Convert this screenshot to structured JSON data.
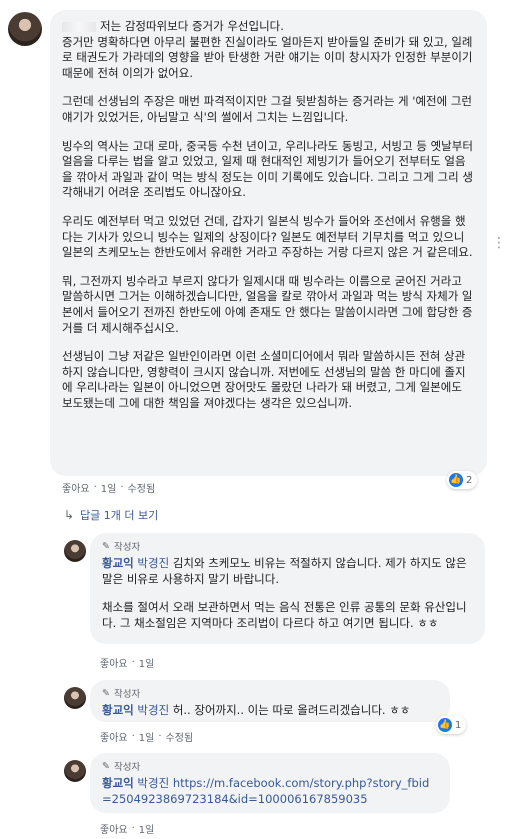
{
  "main_comment": {
    "paragraphs": [
      "저는 감정따위보다 증거가 우선입니다.\n증거만 명확하다면 아무리 불편한 진실이라도 얼마든지 받아들일 준비가 돼 있고, 일례로 태권도가 가라데의 영향을 받아 탄생한 거란 얘기는 이미 창시자가 인정한 부분이기 때문에 전혀 이의가 없어요.",
      "그런데 선생님의 주장은 매번 파격적이지만 그걸 뒷받침하는 증거라는 게 '예전에 그런 얘기가 있었거든, 아님말고 식'의 썰에서 그치는 느낌입니다.",
      "빙수의 역사는 고대 로마, 중국등 수천 년이고, 우리나라도 동빙고, 서빙고 등 옛날부터 얼음을 다루는 법을 알고 있었고, 일제 때 현대적인 제빙기가 들어오기 전부터도 얼음을 깎아서 과일과 같이 먹는 방식 정도는 이미 기록에도 있습니다. 그리고 그게 그리 생각해내기 어려운 조리법도 아니잖아요.",
      "우리도 예전부터 먹고 있었던 건데, 갑자기 일본식 빙수가 들어와 조선에서 유행을 했다는 기사가 있으니 빙수는 일제의 상징이다? 일본도 예전부터 기무치를 먹고 있으니 일본의 츠케모노는 한반도에서 유래한 거라고 주장하는 거랑 다르지 않은 거 같은데요.",
      "뭐, 그전까지 빙수라고 부르지 않다가 일제시대 때 빙수라는 이름으로 굳어진 거라고 말씀하시면 그거는 이해하겠습니다만, 얼음을 칼로 깎아서 과일과 먹는 방식 자체가 일본에서 들어오기 전까진 한반도에 아예 존재도 안 했다는 말씀이시라면 그에 합당한 증거를 더 제시해주십시오.",
      "선생님이 그냥 저같은 일반인이라면 이런 소셜미디어에서 뭐라 말씀하시든 전혀 상관하지 않습니다만, 영향력이 크시지 않습니까. 저번에도 선생님의 말씀 한 마디에 졸지에 우리나라는 일본이 아니었으면 장어맛도 몰랐던 나라가 돼 버렸고, 그게 일본에도 보도됐는데 그에 대한 책임을 져야겠다는 생각은 있으십니까."
    ],
    "actions": {
      "like": "좋아요",
      "reply": "1일",
      "edited": "수정됨"
    },
    "reaction_count": "2",
    "more_icon": "⋮"
  },
  "replies_link": {
    "label": "답글 1개 더 보기",
    "icon": "reply-arrow-icon"
  },
  "replies": [
    {
      "badge": "작성자",
      "author": "황교익",
      "tagged": "박경진",
      "paragraphs": [
        "김치와 츠케모노 비유는 적절하지 않습니다. 제가 하지도 않은 말은 비유로 사용하지 말기 바랍니다.",
        "채소를 절여서 오래 보관하면서 먹는 음식 전통은 인류 공통의 문화 유산입니다. 그 채소절임은 지역마다 조리법이 다르다 하고 여기면 됩니다. ㅎㅎ"
      ],
      "actions": {
        "like": "좋아요",
        "time": "1일"
      }
    },
    {
      "badge": "작성자",
      "author": "황교익",
      "tagged": "박경진",
      "text": "허.. 장어까지.. 이는 따로 올려드리겠습니다. ㅎㅎ",
      "actions": {
        "like": "좋아요",
        "time": "1일",
        "edited": "수정됨"
      },
      "reaction_count": "1"
    },
    {
      "badge": "작성자",
      "author": "황교익",
      "tagged": "박경진",
      "link": "https://m.facebook.com/story.php?story_fbid=2504923869723184&id=100006167859035",
      "actions": {
        "like": "좋아요",
        "time": "1일"
      }
    }
  ],
  "colors": {
    "bubble": "#f2f3f5",
    "link": "#385898",
    "like": "#1877f2",
    "meta": "#606770"
  }
}
